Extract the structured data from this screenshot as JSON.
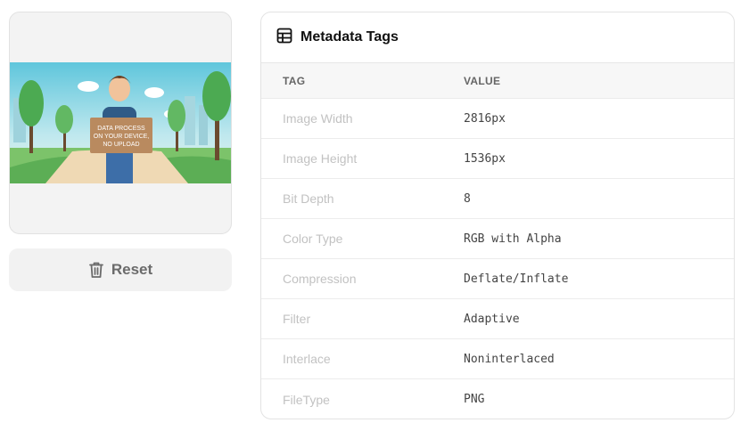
{
  "preview": {
    "sign_lines": [
      "DATA PROCESS",
      "ON YOUR DEVICE,",
      "NO UPLOAD"
    ]
  },
  "reset_button": {
    "label": "Reset",
    "icon": "trash-icon"
  },
  "metadata": {
    "title": "Metadata Tags",
    "icon": "table-icon",
    "columns": {
      "tag": "TAG",
      "value": "VALUE"
    },
    "rows": [
      {
        "tag": "Image Width",
        "value": "2816px"
      },
      {
        "tag": "Image Height",
        "value": "1536px"
      },
      {
        "tag": "Bit Depth",
        "value": "8"
      },
      {
        "tag": "Color Type",
        "value": "RGB with Alpha"
      },
      {
        "tag": "Compression",
        "value": "Deflate/Inflate"
      },
      {
        "tag": "Filter",
        "value": "Adaptive"
      },
      {
        "tag": "Interlace",
        "value": "Noninterlaced"
      },
      {
        "tag": "FileType",
        "value": "PNG"
      }
    ]
  },
  "colors": {
    "tag_text": "#c2c2c2",
    "value_text": "#444444",
    "button_bg": "#f2f2f2"
  }
}
